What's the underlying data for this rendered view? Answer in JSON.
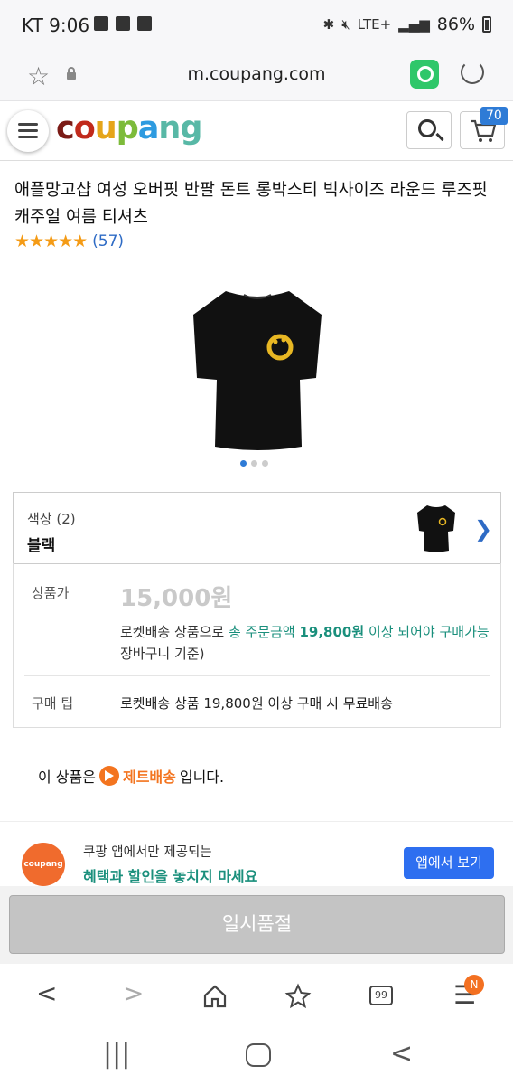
{
  "status": {
    "carrier_time": "KT 9:06",
    "network": "LTE+",
    "battery": "86%"
  },
  "browser": {
    "url": "m.coupang.com"
  },
  "header": {
    "logo_text": "coupang",
    "cart_count": "70"
  },
  "product": {
    "title": "애플망고샵 여성 오버핏 반팔 돈트 롱박스티 빅사이즈 라운드 루즈핏 캐주얼 여름 티셔츠",
    "stars": "★★★★★",
    "review_count": "(57)",
    "image_alt": "black t-shirt with yellow smiley",
    "carousel_dots": 3,
    "carousel_active": 0
  },
  "option": {
    "label": "색상 (2)",
    "value": "블랙"
  },
  "price": {
    "label": "상품가",
    "value": "15,000원",
    "note_prefix": "로켓배송 상품으로 ",
    "note_highlight": "총 주문금액 ",
    "note_amount": "19,800원",
    "note_highlight2": " 이상 되어야 구매가능",
    "note_suffix": " 장바구니 기준)",
    "tip_label": "구매 팁",
    "tip_text": "로켓배송 상품 19,800원 이상 구매 시 무료배송"
  },
  "delivery": {
    "prefix": "이 상품은",
    "jet_label": "제트배송",
    "suffix": "입니다."
  },
  "promo": {
    "badge": "coupang",
    "line1": "쿠팡 앱에서만 제공되는",
    "line2": "혜택과 할인을 놓치지 마세요",
    "button": "앱에서 보기"
  },
  "soldout": {
    "label": "일시품절"
  },
  "browser_bar": {
    "tabs_count": "99",
    "notif_badge": "N"
  },
  "colors": {
    "accent_blue": "#2e6ff0",
    "teal": "#1a8f7c",
    "jet_orange": "#f3741f",
    "star": "#f49b16"
  }
}
